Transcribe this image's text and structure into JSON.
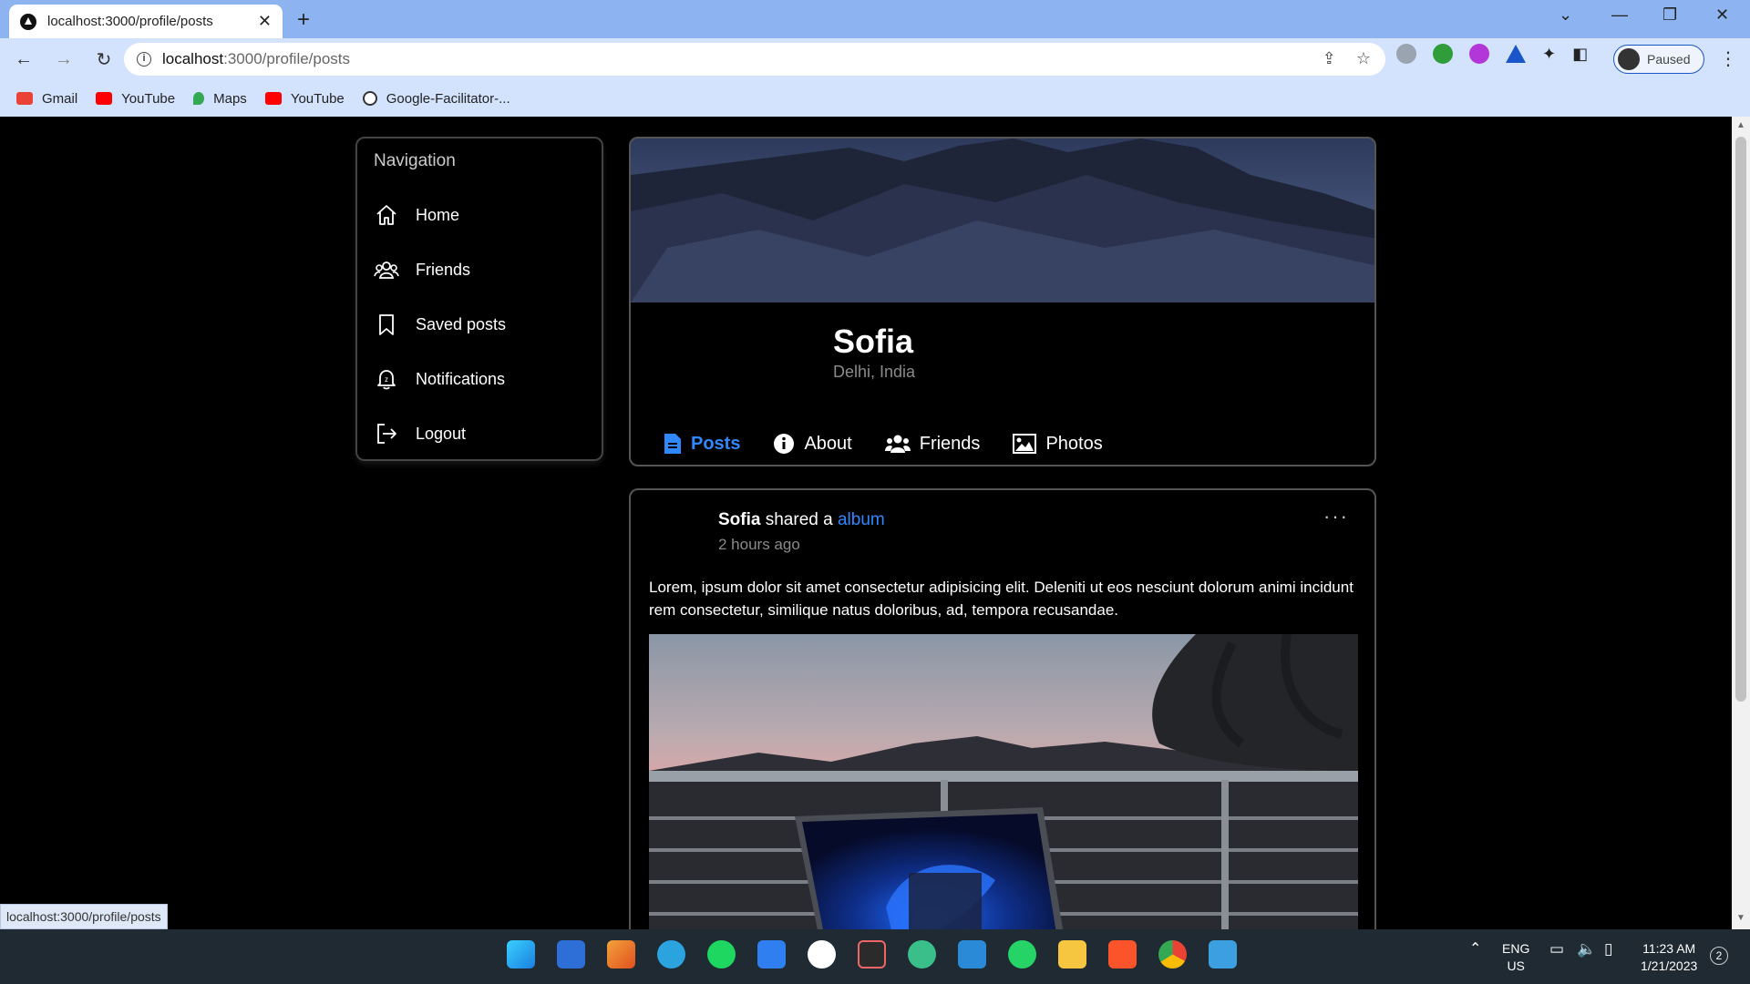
{
  "browser": {
    "tab_title": "localhost:3000/profile/posts",
    "url_host": "localhost",
    "url_path": ":3000/profile/posts",
    "profile_label": "Paused",
    "bookmarks": [
      {
        "label": "Gmail",
        "icon": "gmail-icon",
        "color": "#ea4335"
      },
      {
        "label": "YouTube",
        "icon": "youtube-icon",
        "color": "#ff0000"
      },
      {
        "label": "Maps",
        "icon": "maps-icon",
        "color": "#34a853"
      },
      {
        "label": "YouTube",
        "icon": "youtube-icon",
        "color": "#ff0000"
      },
      {
        "label": "Google-Facilitator-...",
        "icon": "github-icon",
        "color": "#333333"
      }
    ]
  },
  "navigation": {
    "heading": "Navigation",
    "items": [
      {
        "label": "Home",
        "icon": "home-icon"
      },
      {
        "label": "Friends",
        "icon": "friends-icon"
      },
      {
        "label": "Saved posts",
        "icon": "bookmark-icon"
      },
      {
        "label": "Notifications",
        "icon": "bell-icon"
      },
      {
        "label": "Logout",
        "icon": "logout-icon"
      }
    ]
  },
  "profile": {
    "name": "Sofia",
    "location": "Delhi, India",
    "tabs": [
      {
        "label": "Posts",
        "icon": "document-icon",
        "active": true
      },
      {
        "label": "About",
        "icon": "info-icon",
        "active": false
      },
      {
        "label": "Friends",
        "icon": "users-icon",
        "active": false
      },
      {
        "label": "Photos",
        "icon": "image-icon",
        "active": false
      }
    ]
  },
  "post": {
    "author": "Sofia",
    "action": "shared a",
    "link": "album",
    "time": "2 hours ago",
    "text": "Lorem, ipsum dolor sit amet consectetur adipisicing elit. Deleniti ut eos nesciunt dolorum animi incidunt rem consectetur, similique natus doloribus, ad, tempora recusandae.",
    "more": "···"
  },
  "status_url": "localhost:3000/profile/posts",
  "taskbar": {
    "lang_1": "ENG",
    "lang_2": "US",
    "time": "11:23 AM",
    "date": "1/21/2023",
    "notifications": "2"
  },
  "colors": {
    "accent": "#2f88ff",
    "tabbar": "#8db4f0",
    "toolbar": "#d3e3fd"
  }
}
